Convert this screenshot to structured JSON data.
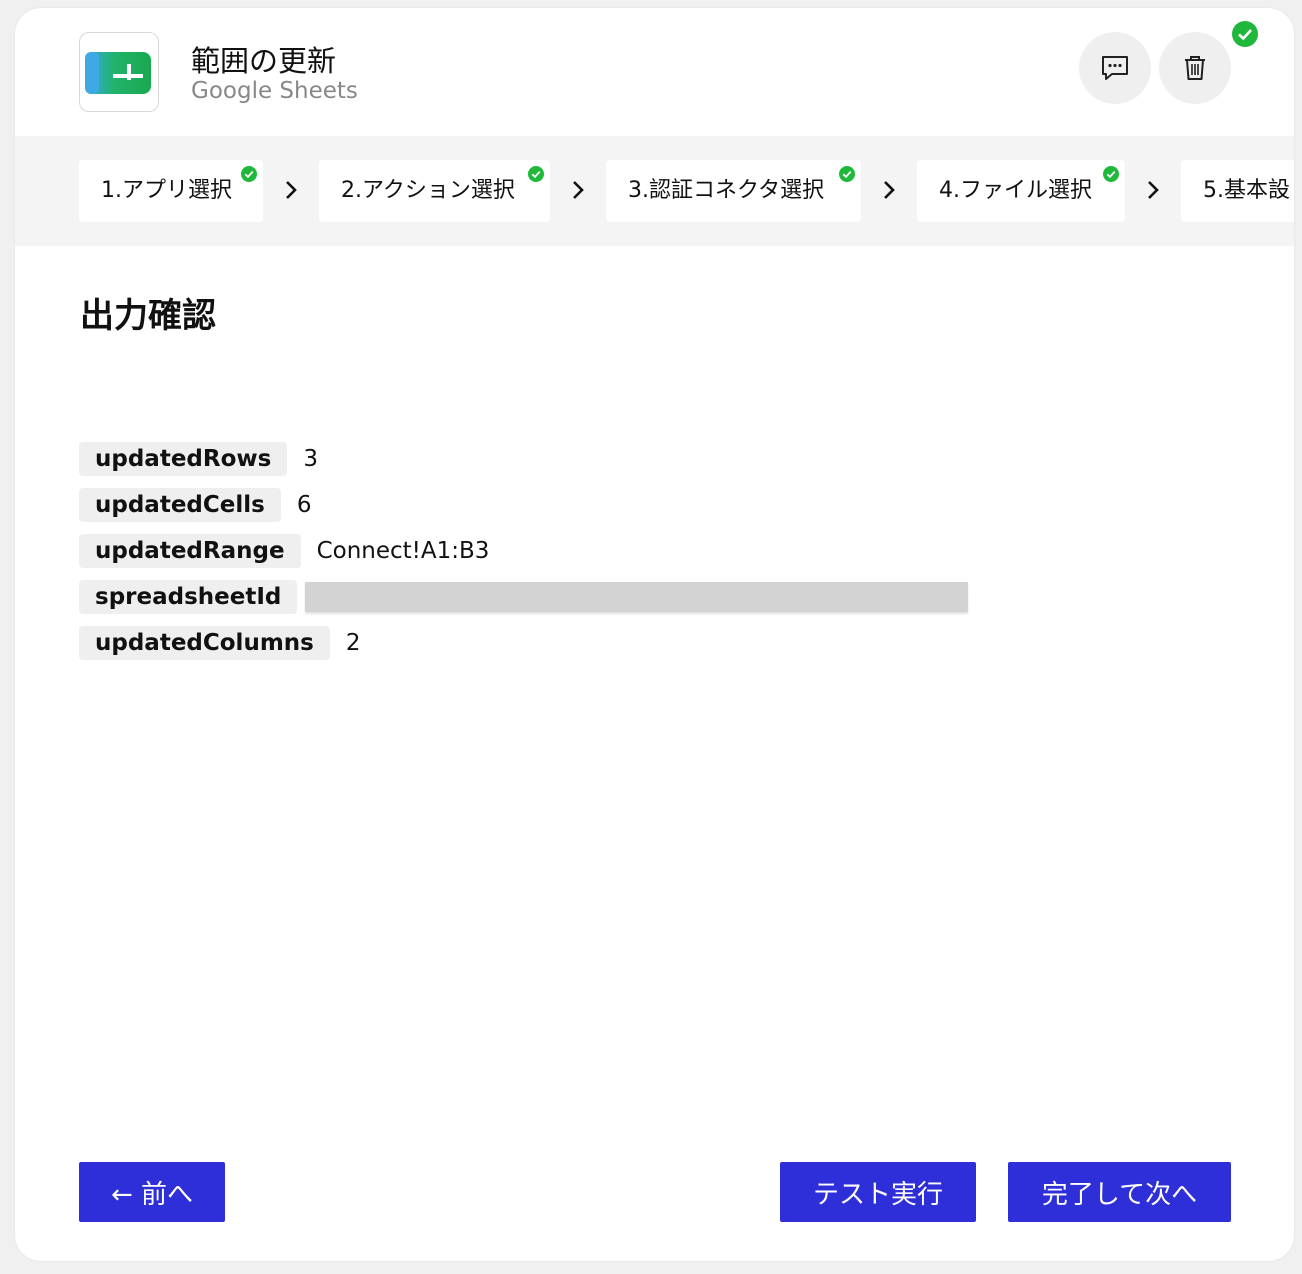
{
  "header": {
    "title": "範囲の更新",
    "subtitle": "Google Sheets",
    "app_icon": "google-sheets-icon",
    "comment_icon": "comment-icon",
    "trash_icon": "trash-icon",
    "status": "completed"
  },
  "steps": [
    {
      "label": "1.アプリ選択",
      "done": true
    },
    {
      "label": "2.アクション選択",
      "done": true
    },
    {
      "label": "3.認証コネクタ選択",
      "done": true
    },
    {
      "label": "4.ファイル選択",
      "done": true
    },
    {
      "label": "5.基本設",
      "done": false
    }
  ],
  "section": {
    "title": "出力確認"
  },
  "outputs": [
    {
      "key": "updatedRows",
      "value": "3"
    },
    {
      "key": "updatedCells",
      "value": "6"
    },
    {
      "key": "updatedRange",
      "value": "Connect!A1:B3"
    },
    {
      "key": "spreadsheetId",
      "value": null,
      "redacted": true
    },
    {
      "key": "updatedColumns",
      "value": "2"
    }
  ],
  "footer": {
    "prev_label": "← 前へ",
    "test_label": "テスト実行",
    "next_label": "完了して次へ"
  },
  "colors": {
    "primary": "#2f2fd9",
    "success": "#1fb83a",
    "sheets_green": "#1aa35a"
  }
}
